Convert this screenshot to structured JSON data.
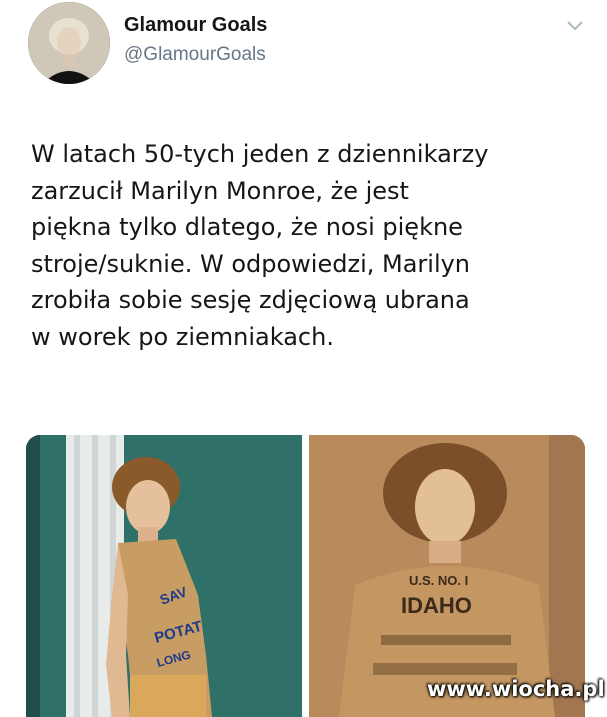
{
  "author": {
    "name": "Glamour Goals",
    "handle": "@GlamourGoals"
  },
  "tweet": {
    "lines": [
      "W latach 50-tych jeden z dziennikarzy",
      "zarzucił Marilyn Monroe, że jest",
      "piękna tylko dlatego, że nosi piękne",
      "stroje/suknie. W odpowiedzi, Marilyn",
      "zrobiła sobie sesję zdjęciową ubrana",
      "w worek po ziemniakach."
    ]
  },
  "media": {
    "left_sack_text": [
      "SAV",
      "POTAT",
      "LONG"
    ],
    "right_sack_text": [
      "U.S. NO. I",
      "IDAHO"
    ]
  },
  "watermark": "www.wiocha.pl",
  "icons": {
    "menu": "chevron-down-icon"
  },
  "colors": {
    "name": "#14171a",
    "handle": "#657786",
    "left_background": "#2f7168",
    "right_background": "#b88a5c"
  }
}
